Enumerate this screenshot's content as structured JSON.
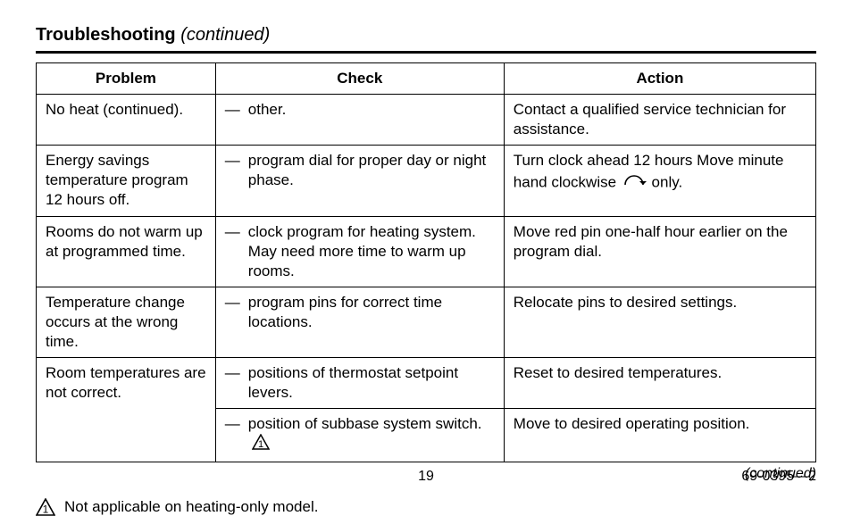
{
  "title": {
    "main": "Troubleshooting",
    "suffix": "(continued)"
  },
  "headers": {
    "problem": "Problem",
    "check": "Check",
    "action": "Action"
  },
  "rows": {
    "r1": {
      "problem": "No heat (continued).",
      "check": "other.",
      "action": "Contact a qualified service technician for assistance."
    },
    "r2": {
      "problem": "Energy savings temperature program 12 hours off.",
      "check": "program dial for proper day or night phase.",
      "action_a": "Turn clock ahead 12 hours Move minute hand clockwise",
      "action_b": "only."
    },
    "r3": {
      "problem": "Rooms do not warm up at programmed time.",
      "check": "clock program for heating system. May need more time to warm up rooms.",
      "action": "Move red pin one-half hour earlier on the program dial."
    },
    "r4": {
      "problem": "Temperature change occurs at the wrong time.",
      "check": "program pins for correct time locations.",
      "action": "Relocate pins to desired settings."
    },
    "r5": {
      "problem": "Room temperatures are not correct.",
      "check_a": "positions of thermostat setpoint levers.",
      "action_a": "Reset to desired temperatures.",
      "check_b": "position of subbase system switch.",
      "action_b": "Move to desired operating position."
    }
  },
  "continued_label": "(continued)",
  "footnote": {
    "marker": "1",
    "text": "Not applicable on heating-only model."
  },
  "footer": {
    "page": "19",
    "doc": "69-0395—2"
  },
  "dash": "—"
}
